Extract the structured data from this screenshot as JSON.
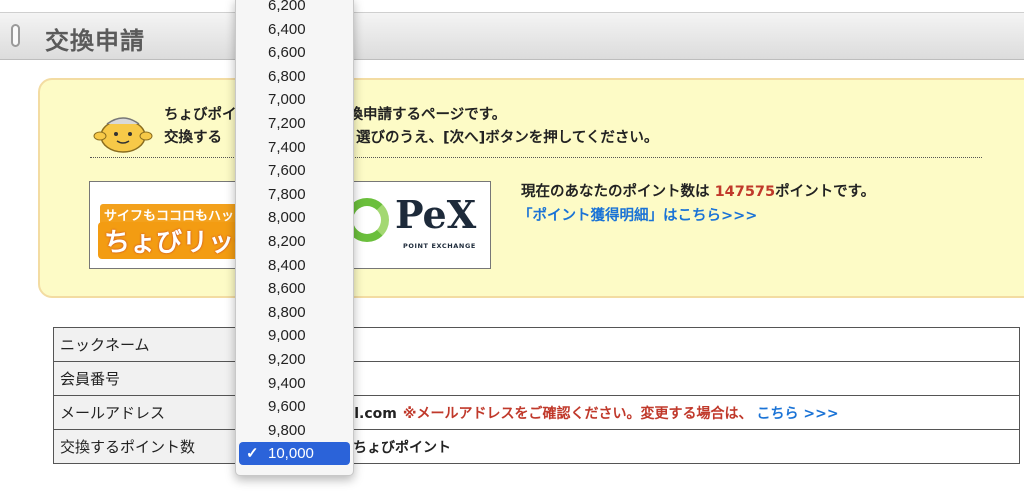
{
  "header": {
    "title": "交換申請"
  },
  "intro": {
    "line1": "ちょびポイ",
    "line1_tail": "換申請するページです。",
    "line2": "交換する",
    "line2_tail": "選びのうえ、[次へ]ボタンを押してください。"
  },
  "logos": {
    "chobirich_tagline": "サイフもココロもハッピーに",
    "chobirich_name": "ちょびリッチ",
    "pex_name": "PeX",
    "pex_sub": "POINT EXCHANGE"
  },
  "points": {
    "prefix": "現在のあなたのポイント数は ",
    "value": "147575",
    "suffix": "ポイントです。",
    "history_link": "「ポイント獲得明細」はこちら>>>"
  },
  "table": {
    "rows": [
      {
        "label": "ニックネーム"
      },
      {
        "label": "会員番号"
      },
      {
        "label": "メールアドレス",
        "email_visible": "ail.com",
        "warning": "※メールアドレスをご確認ください。変更する場合は、",
        "link": "こちら >>>"
      },
      {
        "label": "交換するポイント数",
        "unit": "ちょびポイント"
      }
    ]
  },
  "dropdown": {
    "options": [
      "6,200",
      "6,400",
      "6,600",
      "6,800",
      "7,000",
      "7,200",
      "7,400",
      "7,600",
      "7,800",
      "8,000",
      "8,200",
      "8,400",
      "8,600",
      "8,800",
      "9,000",
      "9,200",
      "9,400",
      "9,600",
      "9,800",
      "10,000"
    ],
    "selected": "10,000",
    "check_icon": "checkmark-icon"
  },
  "colors": {
    "accent_blue": "#1a73d6",
    "warning_red": "#c0392b",
    "selected_bg": "#2b63d9",
    "info_box_bg": "#fdfbc6"
  }
}
